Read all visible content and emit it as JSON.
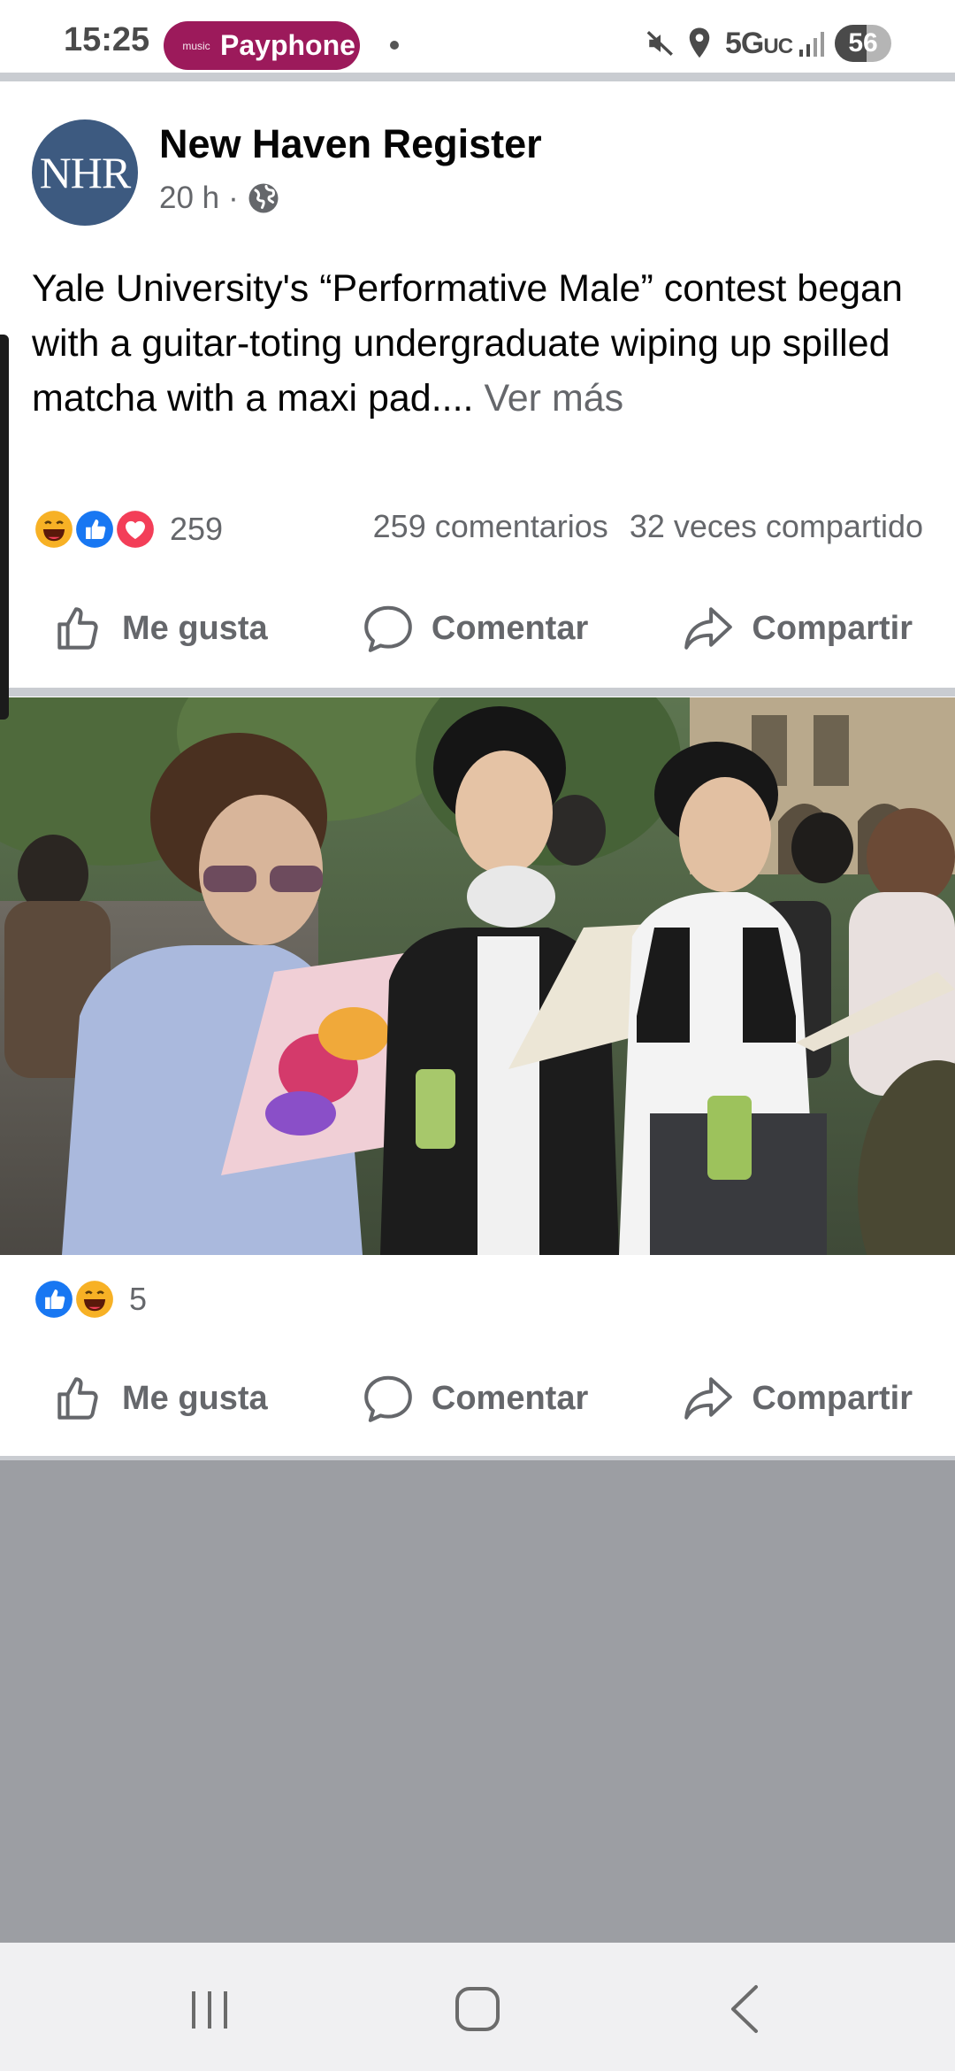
{
  "status_bar": {
    "time": "15:25",
    "music_app": "music",
    "now_playing": "Payphone",
    "network": "5G",
    "network_suffix": "UC",
    "battery_percent": 56
  },
  "post": {
    "page_name": "New Haven Register",
    "avatar_initials": "NHR",
    "time_ago": "20 h",
    "separator": "·",
    "privacy_icon": "globe-icon",
    "text": "Yale University's “Performative Male” contest began with a guitar-toting undergraduate wiping up spilled matcha with a maxi pad.... ",
    "see_more": "Ver más",
    "reaction_count": "259",
    "comments": "259 comentarios",
    "shares": "32 veces compartido",
    "reactions": [
      "haha",
      "like",
      "love"
    ]
  },
  "actions": {
    "like": "Me gusta",
    "comment": "Comentar",
    "share": "Compartir"
  },
  "photo_post": {
    "reaction_count": "5",
    "reactions": [
      "like",
      "haha"
    ]
  },
  "colors": {
    "facebook_blue": "#1877f2",
    "love_red": "#f33e58",
    "haha_yellow": "#f7b125",
    "secondary_text": "#65676b",
    "music_pill": "#9c1a5b"
  }
}
